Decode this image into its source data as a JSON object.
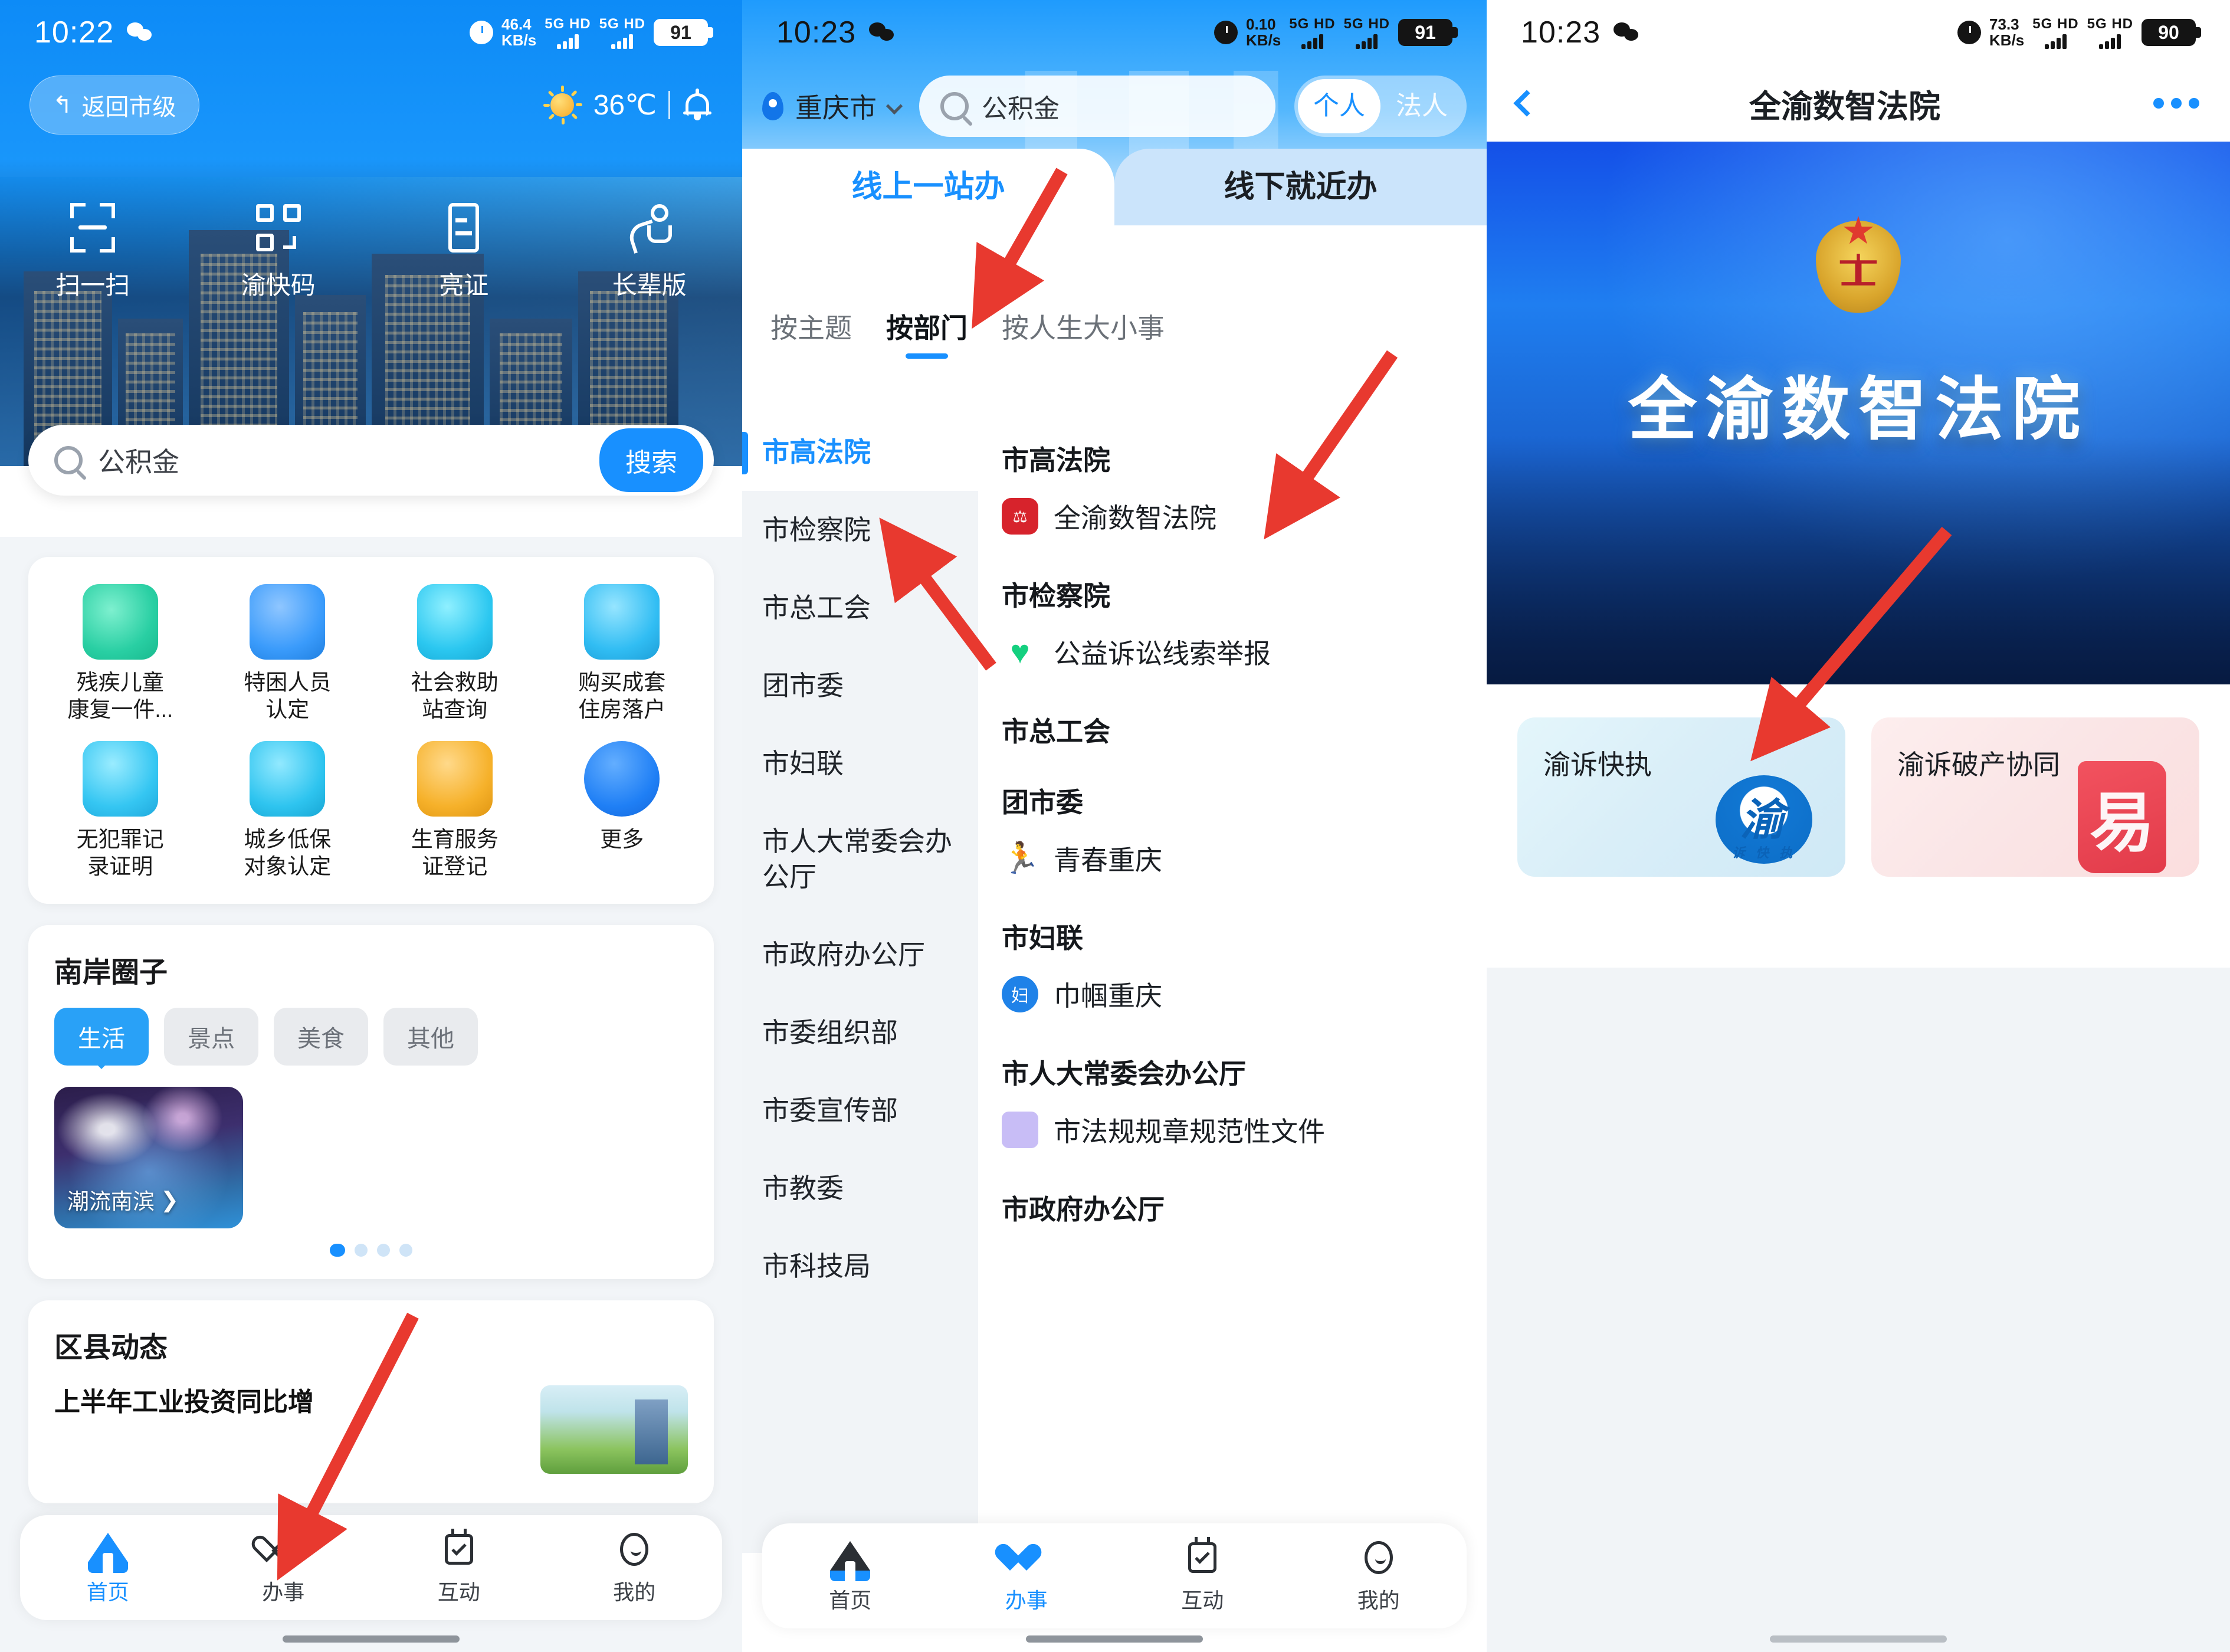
{
  "panel1": {
    "status": {
      "time": "10:22",
      "im_icon": "wechat-icon",
      "alarm_icon": "alarm-icon",
      "net_speed": "46.4",
      "net_unit": "KB/s",
      "sim1": "5G HD",
      "sim2": "5G HD",
      "battery": "91"
    },
    "back_button": "返回市级",
    "weather": {
      "temp": "36℃",
      "icon": "sun-icon",
      "bell_icon": "bell-icon"
    },
    "quick_actions": [
      {
        "label": "扫一扫",
        "icon": "scan-icon"
      },
      {
        "label": "渝快码",
        "icon": "qrcode-icon"
      },
      {
        "label": "亮证",
        "icon": "certificate-icon"
      },
      {
        "label": "长辈版",
        "icon": "elder-mode-icon"
      }
    ],
    "search": {
      "value": "公积金",
      "icon": "search-icon",
      "button": "搜索"
    },
    "services": [
      {
        "label": "残疾儿童\n康复一件...",
        "l1": "残疾儿童",
        "l2": "康复一件...",
        "color": "#2fd0a8"
      },
      {
        "label": "特困人员认定",
        "l1": "特困人员",
        "l2": "认定",
        "color": "#3a9bfb"
      },
      {
        "label": "社会救助站查询",
        "l1": "社会救助",
        "l2": "站查询",
        "color": "#2bc7f0"
      },
      {
        "label": "购买成套住房落户",
        "l1": "购买成套",
        "l2": "住房落户",
        "color": "#31bdf3"
      },
      {
        "label": "无犯罪记录证明",
        "l1": "无犯罪记",
        "l2": "录证明",
        "color": "#35c6f2"
      },
      {
        "label": "城乡低保对象认定",
        "l1": "城乡低保",
        "l2": "对象认定",
        "color": "#2ec4ef"
      },
      {
        "label": "生育服务证登记",
        "l1": "生育服务",
        "l2": "证登记",
        "color": "#f6b12a"
      },
      {
        "label": "更多",
        "l1": "更多",
        "l2": "",
        "color": "#1f7ff5"
      }
    ],
    "circle": {
      "title": "南岸圈子",
      "chips": [
        "生活",
        "景点",
        "美食",
        "其他"
      ],
      "active_chip": "生活",
      "card_caption": "潮流南滨",
      "dots": 4,
      "active_dot": 1
    },
    "district_news": {
      "title": "区县动态",
      "headline": "上半年工业投资同比增"
    },
    "tabbar": [
      {
        "label": "首页",
        "icon": "home-icon",
        "active": true
      },
      {
        "label": "办事",
        "icon": "heart-icon",
        "active": false
      },
      {
        "label": "互动",
        "icon": "calendar-check-icon",
        "active": false
      },
      {
        "label": "我的",
        "icon": "face-icon",
        "active": false
      }
    ]
  },
  "panel2": {
    "status": {
      "time": "10:23",
      "im_icon": "wechat-icon",
      "alarm_icon": "alarm-icon",
      "net_speed": "0.10",
      "net_unit": "KB/s",
      "sim1": "5G HD",
      "sim2": "5G HD",
      "battery": "91"
    },
    "city": "重庆市",
    "search": {
      "value": "公积金",
      "icon": "search-icon"
    },
    "identity": {
      "options": [
        "个人",
        "法人"
      ],
      "selected": "个人"
    },
    "tabs": [
      {
        "label": "线上一站办",
        "active": true
      },
      {
        "label": "线下就近办",
        "active": false
      }
    ],
    "subtabs": [
      {
        "label": "按主题",
        "active": false
      },
      {
        "label": "按部门",
        "active": true
      },
      {
        "label": "按人生大小事",
        "active": false
      }
    ],
    "sidebar": [
      {
        "label": "市高法院",
        "active": true
      },
      {
        "label": "市检察院",
        "active": false
      },
      {
        "label": "市总工会",
        "active": false
      },
      {
        "label": "团市委",
        "active": false
      },
      {
        "label": "市妇联",
        "active": false
      },
      {
        "label": "市人大常委会办公厅",
        "active": false
      },
      {
        "label": "市政府办公厅",
        "active": false
      },
      {
        "label": "市委组织部",
        "active": false
      },
      {
        "label": "市委宣传部",
        "active": false
      },
      {
        "label": "市教委",
        "active": false
      },
      {
        "label": "市科技局",
        "active": false
      }
    ],
    "groups": [
      {
        "name": "市高法院",
        "items": [
          {
            "label": "全渝数智法院",
            "icon": "court-cloud-icon",
            "color": "#d7232c"
          }
        ]
      },
      {
        "name": "市检察院",
        "items": [
          {
            "label": "公益诉讼线索举报",
            "icon": "green-heart-icon",
            "color": "#14d07f"
          }
        ]
      },
      {
        "name": "市总工会",
        "items": []
      },
      {
        "name": "团市委",
        "items": [
          {
            "label": "青春重庆",
            "icon": "youth-runner-icon",
            "color": "#e23b3b"
          }
        ]
      },
      {
        "name": "市妇联",
        "items": [
          {
            "label": "巾帼重庆",
            "icon": "women-federation-icon",
            "color": "#1f82e8"
          }
        ]
      },
      {
        "name": "市人大常委会办公厅",
        "items": [
          {
            "label": "市法规规章规范性文件",
            "icon": "document-person-icon",
            "color": "#9b8cf0"
          }
        ]
      },
      {
        "name": "市政府办公厅",
        "items": []
      }
    ],
    "tabbar": [
      {
        "label": "首页",
        "icon": "home-icon",
        "active": false
      },
      {
        "label": "办事",
        "icon": "heart-icon",
        "active": true
      },
      {
        "label": "互动",
        "icon": "calendar-check-icon",
        "active": false
      },
      {
        "label": "我的",
        "icon": "face-icon",
        "active": false
      }
    ]
  },
  "panel3": {
    "status": {
      "time": "10:23",
      "im_icon": "wechat-icon",
      "alarm_icon": "alarm-icon",
      "net_speed": "73.3",
      "net_unit": "KB/s",
      "sim1": "5G HD",
      "sim2": "5G HD",
      "battery": "90"
    },
    "nav": {
      "back_icon": "back-chevron-icon",
      "title": "全渝数智法院",
      "more_icon": "more-dots-icon"
    },
    "banner": {
      "emblem_icon": "court-emblem-icon",
      "headline": "全渝数智法院"
    },
    "cards": [
      {
        "title": "渝诉快执",
        "logo": "yu-fast-execution-logo",
        "logo_text": "渝",
        "logo_sub": "诉 快 执",
        "theme": "#cfe9f6"
      },
      {
        "title": "渝诉破产协同",
        "logo": "yu-bankruptcy-logo",
        "logo_text": "易",
        "theme": "#fbdede"
      }
    ]
  },
  "accent": {
    "blue": "#1890ff",
    "red_arrow": "#e8392f",
    "bg_gray": "#f1f4f7"
  }
}
